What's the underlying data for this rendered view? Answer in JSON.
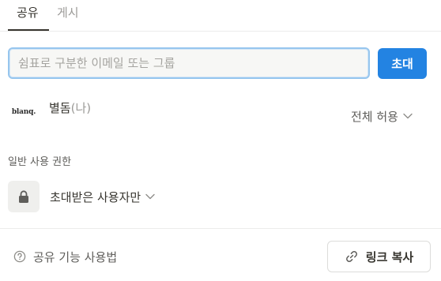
{
  "tabs": [
    {
      "label": "공유",
      "active": true
    },
    {
      "label": "게시",
      "active": false
    }
  ],
  "invite": {
    "placeholder": "쉼표로 구분한 이메일 또는 그룹",
    "value": "",
    "button_label": "초대",
    "button_color": "#2383e2"
  },
  "member": {
    "logo_text": "blanq.",
    "name": "별돔",
    "suffix": "(나)",
    "access": "전체 허용"
  },
  "general_access": {
    "section_label": "일반 사용 권한",
    "icon": "lock-icon",
    "value": "초대받은 사용자만"
  },
  "footer": {
    "help_label": "공유 기능 사용법",
    "help_icon": "question-circle-icon",
    "copy_link_label": "링크 복사",
    "copy_link_icon": "link-icon"
  }
}
